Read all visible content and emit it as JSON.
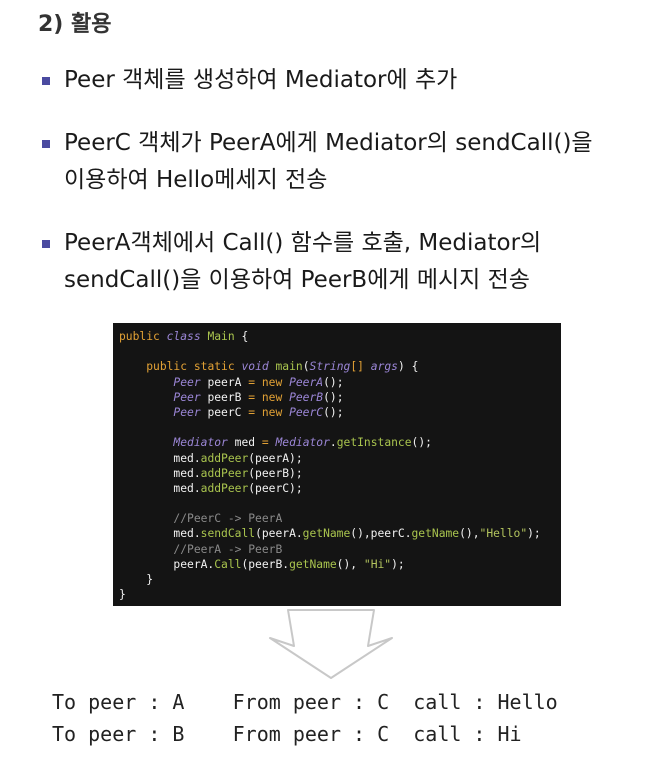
{
  "heading": "2) 활용",
  "bullets": [
    [
      "Peer 객체를 생성하여 Mediator에 추가"
    ],
    [
      "PeerC 객체가 PeerA에게 Mediator의 sendCall()을",
      "이용하여 Hello메세지 전송"
    ],
    [
      "PeerA객체에서 Call() 함수를 호출, Mediator의",
      "sendCall()을 이용하여 PeerB에게 메시지 전송"
    ]
  ],
  "code": {
    "l1": {
      "kw1": "public",
      "kw2": "class",
      "cls": "Main",
      "tail": " {"
    },
    "l3": {
      "kw1": "public",
      "kw2": "static",
      "kw3": "void",
      "fn": "main",
      "p1": "(",
      "ty": "String",
      "br": "[]",
      "arg": "args",
      "tail": ") {"
    },
    "l4": {
      "ty": "Peer",
      "var": " peerA ",
      "eq": "=",
      "nw": " new ",
      "cls": "PeerA",
      "tail": "();"
    },
    "l5": {
      "ty": "Peer",
      "var": " peerB ",
      "eq": "=",
      "nw": " new ",
      "cls": "PeerB",
      "tail": "();"
    },
    "l6": {
      "ty": "Peer",
      "var": " peerC ",
      "eq": "=",
      "nw": " new ",
      "cls": "PeerC",
      "tail": "();"
    },
    "l8": {
      "ty": "Mediator",
      "var": " med ",
      "eq": "=",
      "cls": "Mediator",
      "dot": ".",
      "fn": "getInstance",
      "tail": "();"
    },
    "l9": {
      "obj": "med.",
      "fn": "addPeer",
      "tail": "(peerA);"
    },
    "l10": {
      "obj": "med.",
      "fn": "addPeer",
      "tail": "(peerB);"
    },
    "l11": {
      "obj": "med.",
      "fn": "addPeer",
      "tail": "(peerC);"
    },
    "l13": {
      "cm": "//PeerC -> PeerA"
    },
    "l14": {
      "obj": "med.",
      "fn": "sendCall",
      "a1": "(peerA.",
      "fn2": "getName",
      "a2": "(),peerC.",
      "fn3": "getName",
      "a3": "(),",
      "str": "\"Hello\"",
      "tail": ");"
    },
    "l15": {
      "cm": "//PeerA -> PeerB"
    },
    "l16": {
      "obj": "peerA.",
      "fn": "Call",
      "a1": "(peerB.",
      "fn2": "getName",
      "a2": "(), ",
      "str": "\"Hi\"",
      "tail": ");"
    },
    "l17": {
      "tail": "}"
    },
    "l18": {
      "tail": "}"
    }
  },
  "output": [
    "To peer : A    From peer : C  call : Hello",
    "To peer : B    From peer : C  call : Hi"
  ]
}
